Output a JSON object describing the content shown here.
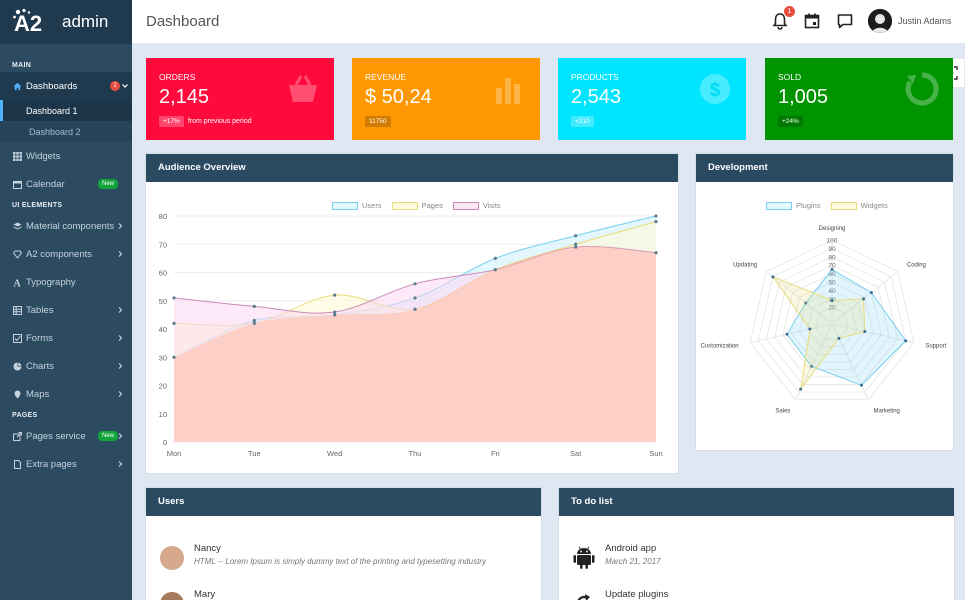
{
  "brand": {
    "mark": "A2",
    "name": "admin"
  },
  "sidebar": {
    "sections": {
      "main": "MAIN",
      "ui": "UI ELEMENTS",
      "pages": "PAGES"
    },
    "dashboards": {
      "label": "Dashboards",
      "badge": "2"
    },
    "dashboard1": "Dashboard 1",
    "dashboard2": "Dashboard 2",
    "widgets": "Widgets",
    "calendar": {
      "label": "Calendar",
      "badge": "New"
    },
    "material": "Material components",
    "a2": "A2 components",
    "typography": "Typography",
    "tables": "Tables",
    "forms": "Forms",
    "charts": "Charts",
    "maps": "Maps",
    "pages_service": {
      "label": "Pages service",
      "badge": "New"
    },
    "extra": "Extra pages"
  },
  "header": {
    "title": "Dashboard",
    "notif_count": "1",
    "user": "Justin Adams"
  },
  "stats": {
    "orders": {
      "label": "ORDERS",
      "value": "2,145",
      "pill": "+17%",
      "note": "from previous period",
      "color": "#ff0a3c"
    },
    "revenue": {
      "label": "REVENUE",
      "value": "$ 50,24",
      "pill": "11750",
      "color": "#ff9800"
    },
    "products": {
      "label": "PRODUCTS",
      "value": "2,543",
      "pill": "+210",
      "color": "#00e5ff"
    },
    "sold": {
      "label": "SOLD",
      "value": "1,005",
      "pill": "+24%",
      "color": "#009400"
    }
  },
  "audience": {
    "title": "Audience Overview",
    "legend": [
      "Users",
      "Pages",
      "Visits"
    ]
  },
  "development": {
    "title": "Development",
    "legend": [
      "Plugins",
      "Widgets"
    ]
  },
  "users": {
    "title": "Users",
    "items": [
      {
        "name": "Nancy",
        "desc": "HTML -- Lorem Ipsum is simply dummy text of the printing and typesetting industry"
      },
      {
        "name": "Mary",
        "desc": ""
      }
    ]
  },
  "todo": {
    "title": "To do list",
    "items": [
      {
        "name": "Android app",
        "date": "March 21, 2017"
      },
      {
        "name": "Update plugins",
        "date": ""
      }
    ]
  },
  "chart_data": [
    {
      "type": "line",
      "categories": [
        "Mon",
        "Tue",
        "Wed",
        "Thu",
        "Fri",
        "Sat",
        "Sun"
      ],
      "ylim": [
        0,
        80
      ],
      "yticks": [
        0,
        10,
        20,
        30,
        40,
        50,
        60,
        70,
        80
      ],
      "legend_position": "top",
      "grid": true,
      "series": [
        {
          "name": "Users",
          "values": [
            30,
            43,
            45,
            51,
            65,
            73,
            80
          ],
          "color": "#7ad0f0"
        },
        {
          "name": "Pages",
          "values": [
            42,
            42,
            52,
            47,
            61,
            70,
            78
          ],
          "color": "#e8dc7c"
        },
        {
          "name": "Visits",
          "values": [
            51,
            48,
            46,
            56,
            61,
            69,
            67
          ],
          "color": "#c98ab8"
        }
      ]
    },
    {
      "type": "radar",
      "axes": [
        "Designing",
        "Coding",
        "Support",
        "Marketing",
        "Sales",
        "Customization",
        "Updating"
      ],
      "rlim": [
        0,
        100
      ],
      "rticks": [
        20,
        30,
        40,
        50,
        60,
        70,
        80,
        90,
        100
      ],
      "legend_position": "top",
      "series": [
        {
          "name": "Plugins",
          "values": [
            65,
            60,
            90,
            81,
            56,
            55,
            40
          ],
          "color": "#7ad0f0"
        },
        {
          "name": "Widgets",
          "values": [
            28,
            48,
            40,
            19,
            86,
            27,
            90
          ],
          "color": "#e8dc7c"
        }
      ]
    }
  ]
}
